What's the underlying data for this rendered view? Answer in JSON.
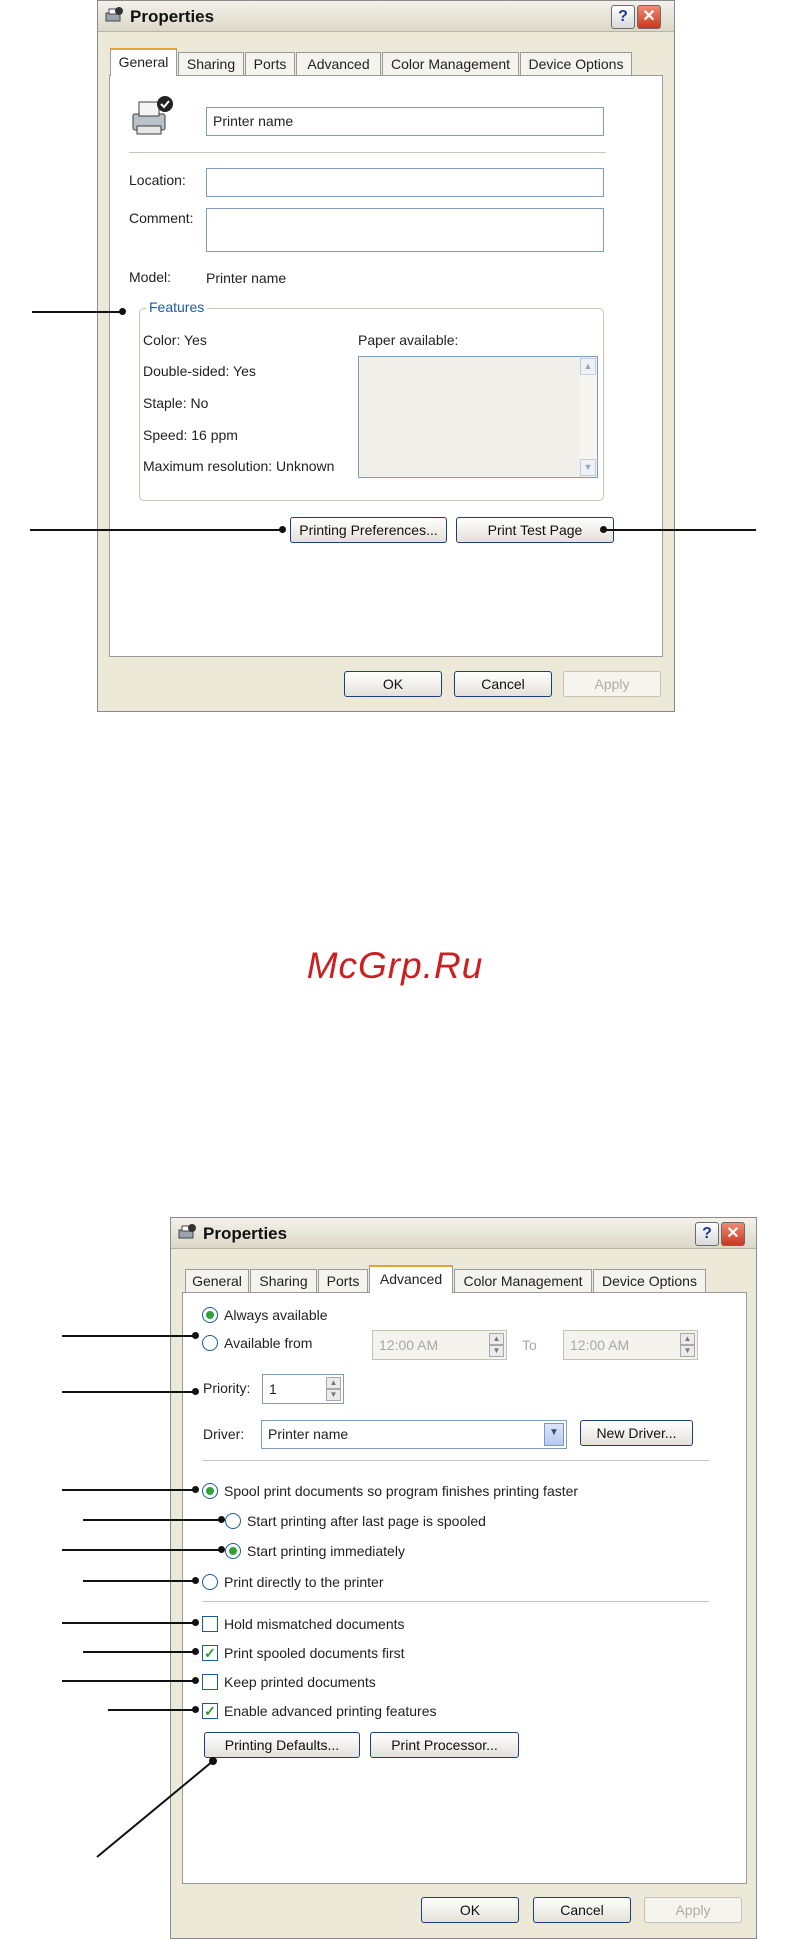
{
  "watermark": "McGrp.Ru",
  "dialog1": {
    "title": "Properties",
    "help_glyph": "?",
    "close_glyph": "✕",
    "tabs": [
      "General",
      "Sharing",
      "Ports",
      "Advanced",
      "Color Management",
      "Device Options"
    ],
    "active_tab": "General",
    "printer_name_value": "Printer name",
    "location_label": "Location:",
    "location_value": "",
    "comment_label": "Comment:",
    "comment_value": "",
    "model_label": "Model:",
    "model_value": "Printer name",
    "features": {
      "title": "Features",
      "color": "Color: Yes",
      "double_sided": "Double-sided: Yes",
      "staple": "Staple: No",
      "speed": "Speed: 16 ppm",
      "max_resolution": "Maximum resolution: Unknown",
      "paper_available_label": "Paper available:"
    },
    "printing_preferences_button": "Printing Preferences...",
    "print_test_page_button": "Print Test Page",
    "ok_button": "OK",
    "cancel_button": "Cancel",
    "apply_button": "Apply"
  },
  "dialog2": {
    "title": "Properties",
    "help_glyph": "?",
    "close_glyph": "✕",
    "tabs": [
      "General",
      "Sharing",
      "Ports",
      "Advanced",
      "Color Management",
      "Device Options"
    ],
    "active_tab": "Advanced",
    "always_available_label": "Always available",
    "always_available_checked": true,
    "available_from_label": "Available from",
    "from_time": "12:00 AM",
    "to_label": "To",
    "to_time": "12:00 AM",
    "priority_label": "Priority:",
    "priority_value": "1",
    "driver_label": "Driver:",
    "driver_value": "Printer name",
    "new_driver_button": "New Driver...",
    "spool_label": "Spool print documents so program finishes printing faster",
    "spool_checked": true,
    "start_after_last_label": "Start printing after last page is spooled",
    "start_after_last_checked": false,
    "start_immediately_label": "Start printing immediately",
    "start_immediately_checked": true,
    "print_directly_label": "Print directly to the printer",
    "print_directly_checked": false,
    "hold_mismatched_label": "Hold mismatched documents",
    "hold_mismatched_checked": false,
    "print_spooled_first_label": "Print spooled documents first",
    "print_spooled_first_checked": true,
    "keep_printed_label": "Keep printed documents",
    "keep_printed_checked": false,
    "enable_advanced_label": "Enable advanced printing features",
    "enable_advanced_checked": true,
    "printing_defaults_button": "Printing Defaults...",
    "print_processor_button": "Print Processor...",
    "ok_button": "OK",
    "cancel_button": "Cancel",
    "apply_button": "Apply"
  },
  "icons": {
    "check_glyph": "✓",
    "spin_up": "▲",
    "spin_down": "▼",
    "combo_arrow": "▼",
    "scroll_up": "▲",
    "scroll_down": "▼"
  }
}
